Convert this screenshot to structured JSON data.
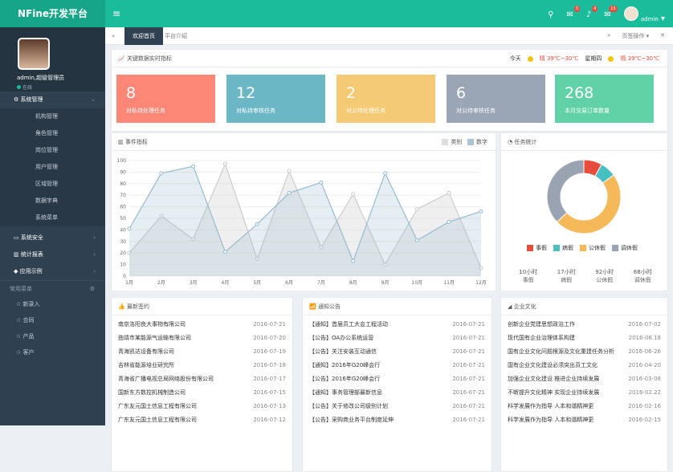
{
  "brand": "NFine开发平台",
  "topbar": {
    "mail_count": "3",
    "bell_count": "4",
    "msg_count": "15",
    "user": "admin"
  },
  "sidebar": {
    "user_name": "admin,超级管理员",
    "status": "在线",
    "system_label": "系统管理",
    "sub_items": [
      "机构管理",
      "角色管理",
      "岗位管理",
      "用户管理",
      "区域管理",
      "数据字典",
      "系统菜单"
    ],
    "other_items": [
      "系统安全",
      "统计报表",
      "应用示例"
    ],
    "quick_title": "常用菜单",
    "quick_items": [
      "新录入",
      "合同",
      "产品",
      "客户"
    ]
  },
  "tabs": {
    "home": "欢迎首页",
    "second": "平台介绍",
    "page_ops": "页签操作"
  },
  "indicator": {
    "title": "关键数据实时指标",
    "weather_today": "今天",
    "weather_today_text": "晴 39℃~30℃",
    "weather_week": "星期四",
    "weather_week_text": "晴 39℃~30℃",
    "stats": [
      {
        "num": "8",
        "label": "对私待处理任务",
        "color": "#fd8777"
      },
      {
        "num": "12",
        "label": "对私待审核任务",
        "color": "#6bb7c6"
      },
      {
        "num": "2",
        "label": "对公待处理任务",
        "color": "#f5ca75"
      },
      {
        "num": "6",
        "label": "对公待审核任务",
        "color": "#9aa5b5"
      },
      {
        "num": "268",
        "label": "本月交易订单数量",
        "color": "#61d1a8"
      }
    ]
  },
  "chart_panel": {
    "title": "事件指标",
    "legend_a": "类别",
    "legend_b": "数字"
  },
  "chart_data": {
    "type": "area",
    "categories": [
      "1月",
      "2月",
      "3月",
      "4月",
      "5月",
      "6月",
      "7月",
      "8月",
      "9月",
      "10月",
      "11月",
      "12月"
    ],
    "ylim": [
      0,
      100
    ],
    "yticks": [
      "0",
      "10",
      "20",
      "30",
      "40",
      "50",
      "60",
      "70",
      "80",
      "90",
      "100"
    ],
    "series": [
      {
        "name": "类别",
        "values": [
          20,
          52,
          32,
          97,
          15,
          91,
          25,
          71,
          10,
          58,
          72,
          7
        ]
      },
      {
        "name": "数字",
        "values": [
          41,
          89,
          95,
          21,
          45,
          72,
          81,
          13,
          89,
          31,
          47,
          56
        ]
      }
    ]
  },
  "pie_panel": {
    "title": "任务统计",
    "legend": [
      "事假",
      "病假",
      "公休假",
      "调休假"
    ],
    "slices": [
      8,
      7,
      48,
      37
    ],
    "colors": [
      "#e74c3c",
      "#48c0c1",
      "#f5b95a",
      "#9aa3b2"
    ],
    "stats": [
      {
        "value": "10小时",
        "label": "事假"
      },
      {
        "value": "17小时",
        "label": "病假"
      },
      {
        "value": "92小时",
        "label": "公休假"
      },
      {
        "value": "68小时",
        "label": "调休假"
      }
    ]
  },
  "lists": [
    {
      "title": "最新签约",
      "rows": [
        [
          "南京洛阳良大事物有限公司",
          "2016-07-21"
        ],
        [
          "曲靖市某能源气运输有限公司",
          "2016-07-20"
        ],
        [
          "青海凯达设备有限公司",
          "2016-07-19"
        ],
        [
          "吉林省能源培业研究所",
          "2016-07-18"
        ],
        [
          "青海省广播电视总局网络股份有限公司",
          "2016-07-17"
        ],
        [
          "国新东方数控机械制造公司",
          "2016-07-15"
        ],
        [
          "广东友元国土信息工程有限公司",
          "2016-07-13"
        ],
        [
          "广东友元国土信息工程有限公司",
          "2016-07-12"
        ]
      ]
    },
    {
      "title": "通知公告",
      "rows": [
        [
          "【通知】首届员工大会工程活动",
          "2016-07-21"
        ],
        [
          "【公告】OA办公系统运营",
          "2016-07-21"
        ],
        [
          "【公告】关注安装互动通信",
          "2016-07-21"
        ],
        [
          "【通知】2016年G20峰会行",
          "2016-07-21"
        ],
        [
          "【公告】2016年G20峰会行",
          "2016-07-21"
        ],
        [
          "【通知】事务管理部最新信息",
          "2016-07-21"
        ],
        [
          "【公告】关于修改公司级别计划",
          "2016-07-21"
        ],
        [
          "【公告】采购商业务平台制度延伸",
          "2016-07-21"
        ]
      ]
    },
    {
      "title": "企业文化",
      "rows": [
        [
          "创新企业党建思想政治工作",
          "2016-07-02"
        ],
        [
          "现代国有企业治理体系构建",
          "2016-06.18"
        ],
        [
          "国有企业文化问题根源及文化重建任务分析",
          "2016-06-26"
        ],
        [
          "国有企业文化建设必须突出员工文化",
          "2016-04-20"
        ],
        [
          "加强企业文化建设 推进企业持续发展",
          "2016-03-08"
        ],
        [
          "不断提升文化精神 实现企业持续发展",
          "2016-02.22"
        ],
        [
          "科学发展作为指导 人本和谐精神更",
          "2016-02-16"
        ],
        [
          "科学发展作为指导 人本和谐精神更",
          "2016-02-15"
        ]
      ]
    }
  ]
}
